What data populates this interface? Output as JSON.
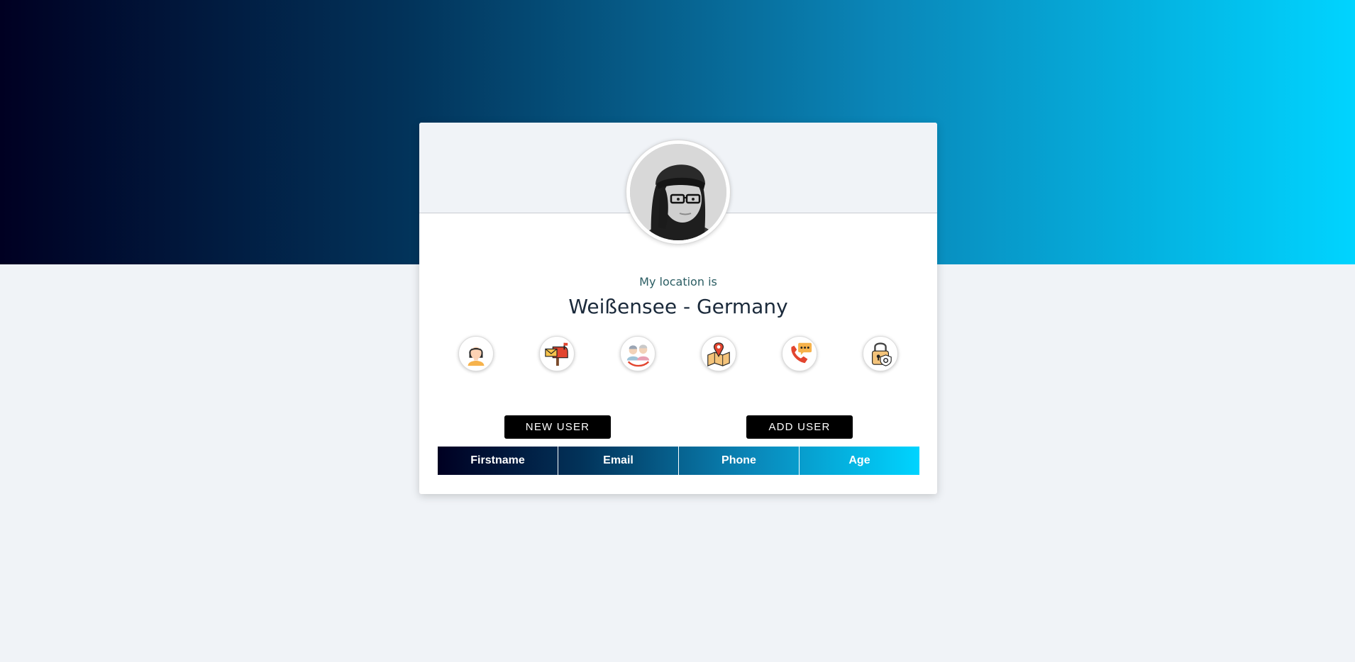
{
  "profile": {
    "avatar_alt": "user avatar",
    "subtitle": "My location is",
    "value": "Weißensee - Germany"
  },
  "info_icons": [
    {
      "name": "user-icon"
    },
    {
      "name": "mailbox-icon"
    },
    {
      "name": "age-icon"
    },
    {
      "name": "map-icon"
    },
    {
      "name": "phone-icon"
    },
    {
      "name": "password-lock-icon"
    }
  ],
  "actions": {
    "new_user": "NEW USER",
    "add_user": "ADD USER"
  },
  "table": {
    "columns": [
      "Firstname",
      "Email",
      "Phone",
      "Age"
    ],
    "rows": []
  },
  "colors": {
    "gradient_start": "#000022",
    "gradient_end": "#00d4ff",
    "page_bg": "#f0f3f7",
    "button_bg": "#000000"
  }
}
